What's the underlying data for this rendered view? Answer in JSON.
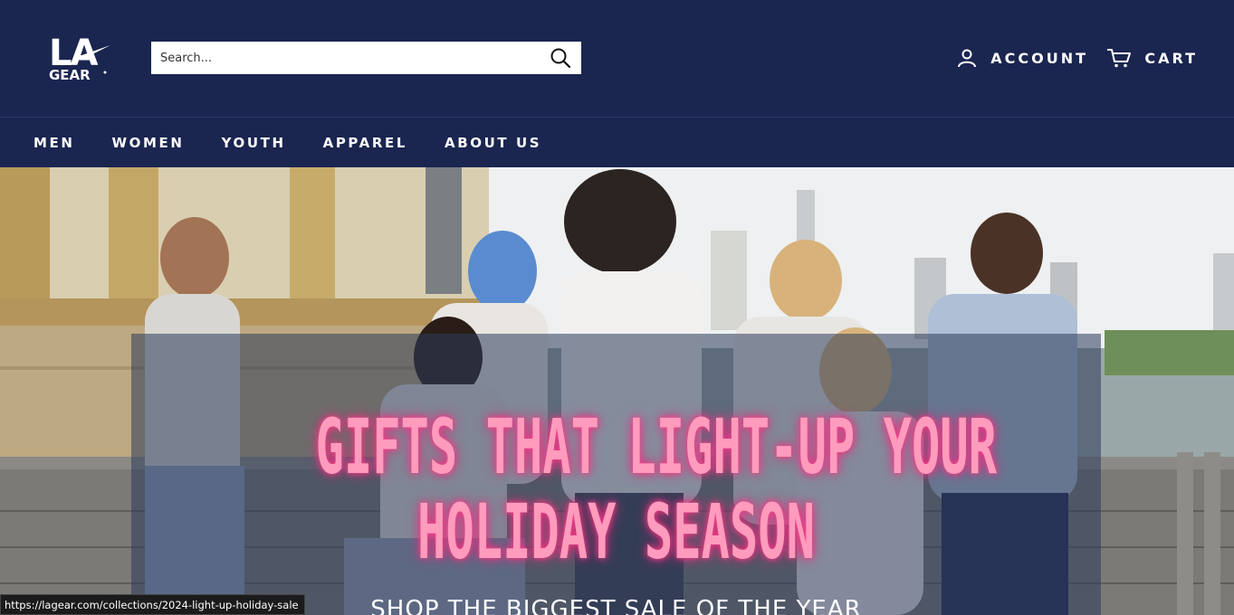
{
  "header": {
    "logo_name": "la-gear-logo",
    "search": {
      "placeholder": "Search..."
    },
    "account_label": "ACCOUNT",
    "cart_label": "CART"
  },
  "nav": {
    "items": [
      {
        "label": "MEN"
      },
      {
        "label": "WOMEN"
      },
      {
        "label": "YOUTH"
      },
      {
        "label": "APPAREL"
      },
      {
        "label": "ABOUT US"
      }
    ]
  },
  "hero": {
    "headline_line1": "GIFTS THAT LIGHT-UP YOUR",
    "headline_line2": "HOLIDAY SEASON",
    "subline": "SHOP THE BIGGEST SALE OF THE YEAR"
  },
  "status_bar": {
    "url": "https://lagear.com/collections/2024-light-up-holiday-sale"
  },
  "colors": {
    "header_bg": "#1a2550",
    "headline_pink": "#ff9bbd",
    "overlay": "#2c3a5a"
  },
  "icons": [
    "search-icon",
    "account-icon",
    "cart-icon"
  ]
}
